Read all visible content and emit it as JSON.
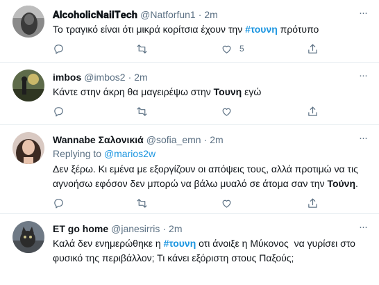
{
  "tweets": [
    {
      "name": "𝐀𝐥𝐜𝐨𝐡𝐨𝐥𝐢𝐜𝐍𝐚𝐢𝐥𝐓𝐞𝐜𝐡",
      "handle": "@Natforfun1",
      "dot": "·",
      "time": "2m",
      "text": {
        "pre": "Το τραγικό είναι ότι μικρά κορίτσια έχουν την ",
        "tag": "#τουνη",
        "post": " πρότυπο"
      },
      "likes": "5"
    },
    {
      "name": "imbos",
      "handle": "@imbos2",
      "dot": "·",
      "time": "2m",
      "text": {
        "pre": "Κάντε στην άκρη θα μαγειρέψω στην ",
        "bold": "Τουνη",
        "post": " εγώ"
      }
    },
    {
      "name": "Wannabe Σαλονικιά",
      "handle": "@sofia_emn",
      "dot": "·",
      "time": "2m",
      "replying_label": "Replying to",
      "replying_to": "@marios2w",
      "text": {
        "line1": "Δεν ξέρω. Κι εμένα με εξοργίζουν οι απόψεις τους, αλλά προτιμώ να τις",
        "line2_pre": "αγνοήσω εφόσον δεν μπορώ να βάλω μυαλό σε άτομα σαν την ",
        "bold": "Τούνη",
        "line2_post": "."
      }
    },
    {
      "name": "ET go home",
      "handle": "@janesirris",
      "dot": "·",
      "time": "2m",
      "text": {
        "pre": "Καλά δεν ενημερώθηκε η ",
        "tag": "#τουνη",
        "mid": " οτι άνοιξε η Μύκονος  να γυρίσει στο",
        "line2": "φυσικό της περιβάλλον; Τι κάνει εξόριστη στους Παξούς;"
      }
    }
  ],
  "colors": {
    "accent": "#1b95e0",
    "muted": "#5b7083",
    "border": "#e6ecf0"
  }
}
